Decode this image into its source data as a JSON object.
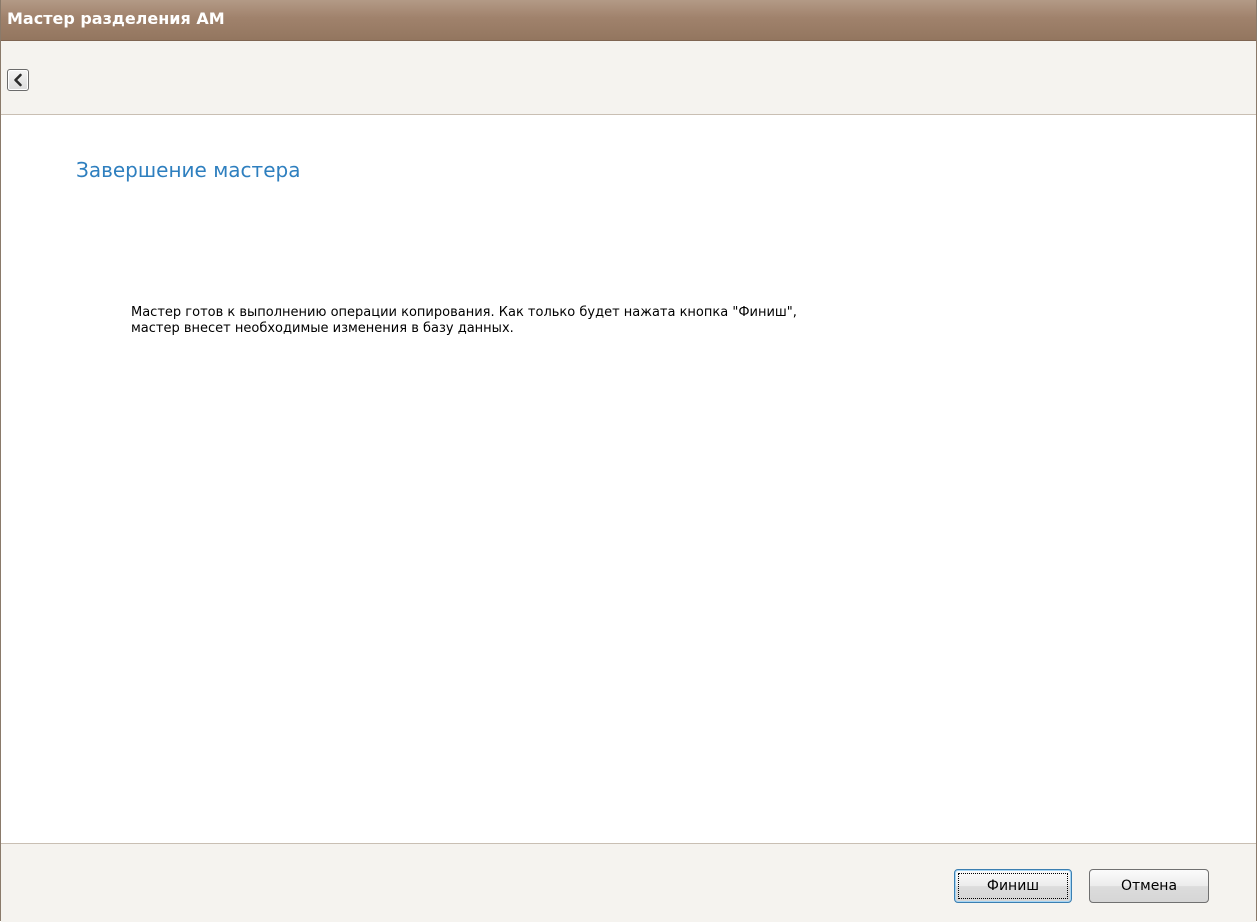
{
  "window": {
    "title": "Мастер разделения АМ"
  },
  "toolbar": {
    "back_icon": "chevron-left-icon"
  },
  "content": {
    "page_title": "Завершение мастера",
    "description_line1": "Мастер готов к выполнению операции копирования. Как только будет нажата кнопка \"Финиш\",",
    "description_line2": "мастер внесет необходимые изменения в базу данных."
  },
  "footer": {
    "finish_label": "Финиш",
    "cancel_label": "Отмена"
  },
  "colors": {
    "titlebar": "#a0826c",
    "page_title": "#2e7fbf",
    "panel_background": "#f5f3ef"
  }
}
